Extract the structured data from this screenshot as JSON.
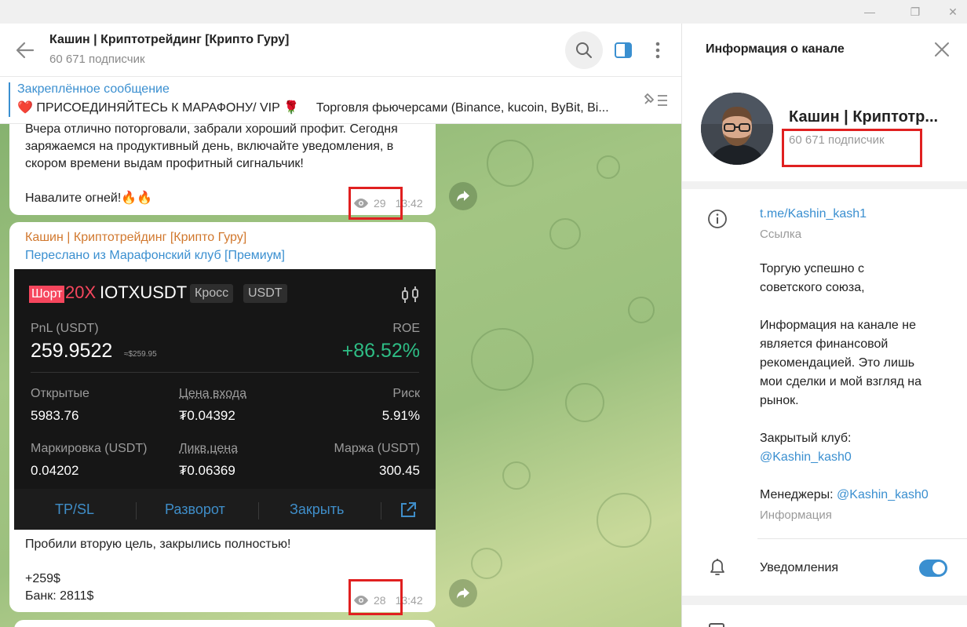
{
  "window": {
    "minimize": "—",
    "maximize": "❐",
    "close": "✕"
  },
  "chat": {
    "title": "Кашин | Криптотрейдинг [Крипто Гуру]",
    "subscribers": "60 671 подписчик"
  },
  "pinned": {
    "title": "Закреплённое сообщение",
    "heart": "❤️",
    "text": "ПРИСОЕДИНЯЙТЕСЬ К МАРАФОНУ/ VIP",
    "rose": "🌹",
    "text2": "Торговля фьючерсами (Binance, kucoin, ByBit, Bi..."
  },
  "messages": [
    {
      "lines": [
        "Вчера отлично поторговали, забрали хороший профит. Сегодня",
        "заряжаемся на продуктивный день, включайте уведомления, в",
        "скором времени выдам профитный сигнальчик!",
        "",
        "Навалите огней!🔥🔥"
      ],
      "views": "29",
      "time": "13:42"
    },
    {
      "author": "Кашин | Криптотрейдинг [Крипто Гуру]",
      "forwarded": "Переслано из Марафонский клуб [Премиум]",
      "lines": [
        "Пробили вторую цель, закрылись полностью!",
        "",
        "+259$",
        "Банк: 2811$"
      ],
      "views": "28",
      "time": "13:42"
    }
  ],
  "trade": {
    "side": "Шорт",
    "leverage": "20X",
    "pair": "IOTXUSDT",
    "mode": "Кросс",
    "currency": "USDT",
    "pnl_label": "PnL (USDT)",
    "pnl_value": "259.9522",
    "pnl_approx": "≈$259.95",
    "roe_label": "ROE",
    "roe_value": "+86.52%",
    "open_label": "Открытые",
    "open_value": "5983.76",
    "entry_label": "Цена входа",
    "entry_value": "₮0.04392",
    "risk_label": "Риск",
    "risk_value": "5.91%",
    "mark_label": "Маркировка (USDT)",
    "mark_value": "0.04202",
    "liq_label": "Ликв.цена",
    "liq_value": "₮0.06369",
    "margin_label": "Маржа (USDT)",
    "margin_value": "300.45",
    "btn_tpsl": "TP/SL",
    "btn_reverse": "Разворот",
    "btn_close": "Закрыть"
  },
  "info": {
    "title": "Информация о канале",
    "name": "Кашин | Криптотр...",
    "subscribers": "60 671 подписчик",
    "link": "t.me/Kashin_kash1",
    "link_label": "Ссылка",
    "desc1": [
      "Торгую успешно с",
      "советского союза,"
    ],
    "desc2": [
      "Информация на канале не",
      "является финансовой",
      "рекомендацией. Это лишь",
      "мои сделки и мой взгляд на",
      "рынок."
    ],
    "club_label": "Закрытый клуб:",
    "club_link": "@Kashin_kash0",
    "managers_label": "Менеджеры:",
    "managers_link": "@Kashin_kash0",
    "info_label": "Информация",
    "notifications": "Уведомления"
  },
  "colors": {
    "accent": "#3a8fd0",
    "author": "#d1782e",
    "profit": "#2ebd85",
    "short": "#f6465d",
    "highlight": "#e02020"
  }
}
